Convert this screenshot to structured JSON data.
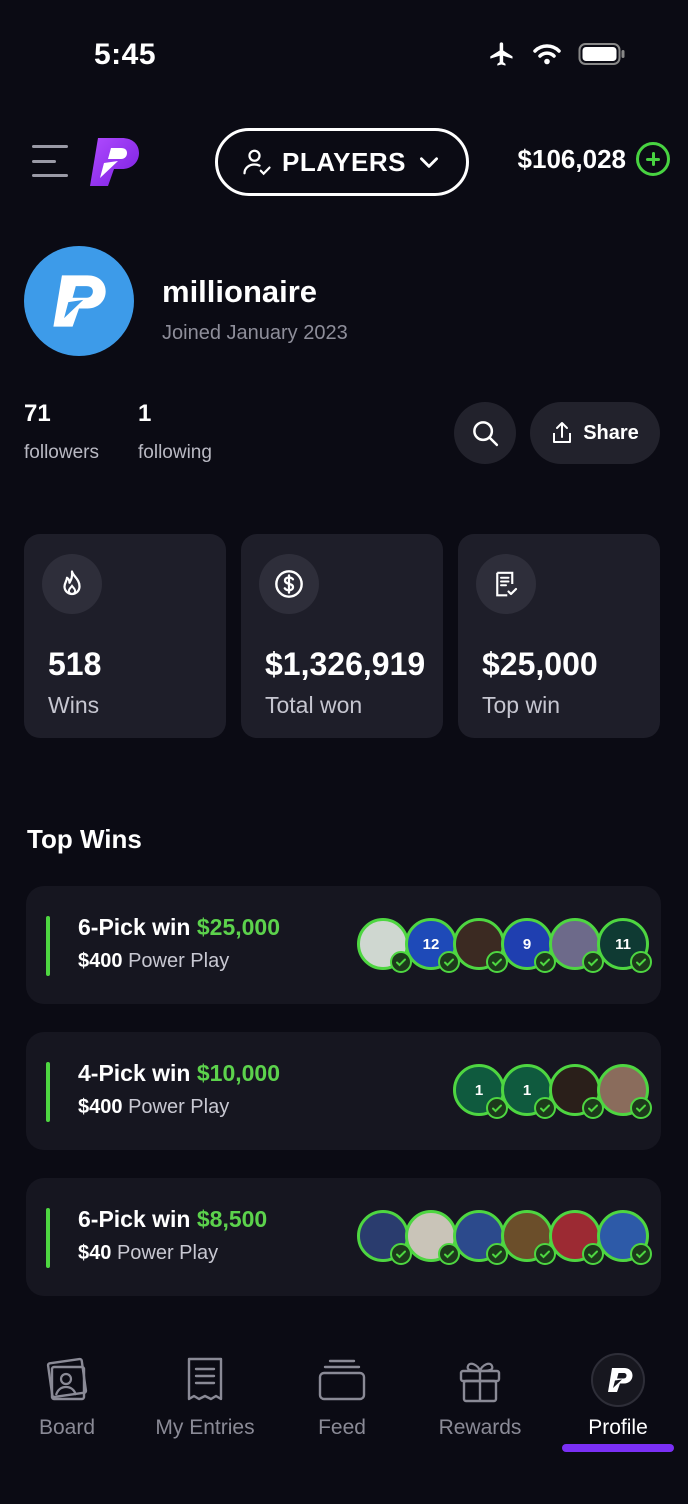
{
  "status_bar": {
    "time": "5:45"
  },
  "header": {
    "players_label": "PLAYERS",
    "balance": "$106,028",
    "accent_color": "#48d341",
    "brand_color": "#8a2cf0"
  },
  "profile": {
    "username": "millionaire",
    "joined": "Joined January 2023",
    "followers_count": "71",
    "followers_label": "followers",
    "following_count": "1",
    "following_label": "following",
    "share_label": "Share",
    "avatar_color": "#3d9be9"
  },
  "stats": [
    {
      "icon": "flame-icon",
      "value": "518",
      "label": "Wins"
    },
    {
      "icon": "dollar-coin-icon",
      "value": "$1,326,919",
      "label": "Total won"
    },
    {
      "icon": "receipt-icon",
      "value": "$25,000",
      "label": "Top win"
    }
  ],
  "top_wins": {
    "title": "Top Wins",
    "items": [
      {
        "pick_text": "6-Pick win",
        "amount": "$25,000",
        "stake": "$400",
        "play_type": "Power Play",
        "players": [
          "",
          "12",
          "",
          "9",
          "",
          "11"
        ]
      },
      {
        "pick_text": "4-Pick win",
        "amount": "$10,000",
        "stake": "$400",
        "play_type": "Power Play",
        "players": [
          "1",
          "1",
          "",
          ""
        ]
      },
      {
        "pick_text": "6-Pick win",
        "amount": "$8,500",
        "stake": "$40",
        "play_type": "Power Play",
        "players": [
          "",
          "",
          "",
          "",
          "",
          ""
        ]
      }
    ]
  },
  "nav": {
    "items": [
      {
        "label": "Board",
        "icon": "board-icon"
      },
      {
        "label": "My Entries",
        "icon": "entries-icon"
      },
      {
        "label": "Feed",
        "icon": "feed-icon"
      },
      {
        "label": "Rewards",
        "icon": "gift-icon"
      },
      {
        "label": "Profile",
        "icon": "profile-logo-icon",
        "active": true
      }
    ],
    "active_color": "#7a2ff5"
  }
}
